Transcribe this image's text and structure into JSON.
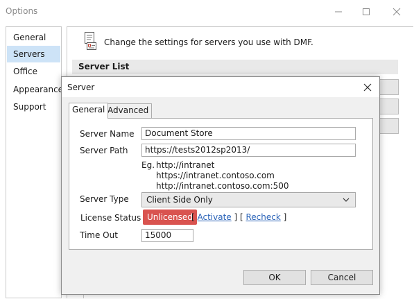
{
  "window": {
    "title": "Options"
  },
  "nav": {
    "items": [
      {
        "label": "General",
        "selected": false
      },
      {
        "label": "Servers",
        "selected": true
      },
      {
        "label": "Office",
        "selected": false
      },
      {
        "label": "Appearance",
        "selected": false
      },
      {
        "label": "Support",
        "selected": false
      }
    ]
  },
  "content": {
    "header_text": "Change the settings for servers you use with DMF.",
    "list_title": "Server List"
  },
  "dialog": {
    "title": "Server",
    "tabs": [
      {
        "label": "General",
        "active": true
      },
      {
        "label": "Advanced",
        "active": false
      }
    ],
    "server_name": {
      "label": "Server Name",
      "value": "Document Store"
    },
    "server_path": {
      "label": "Server Path",
      "value": "https://tests2012sp2013/"
    },
    "examples": {
      "prefix": "Eg.",
      "lines": [
        "http://intranet",
        "https://intranet.contoso.com",
        "http://intranet.contoso.com:500"
      ]
    },
    "server_type": {
      "label": "Server Type",
      "value": "Client Side Only"
    },
    "license": {
      "label": "License Status",
      "status": "Unlicensed",
      "status_color": "#d9534f",
      "activate": "Activate",
      "recheck": "Recheck"
    },
    "timeout": {
      "label": "Time Out",
      "value": "15000"
    },
    "ok_label": "OK",
    "cancel_label": "Cancel"
  }
}
